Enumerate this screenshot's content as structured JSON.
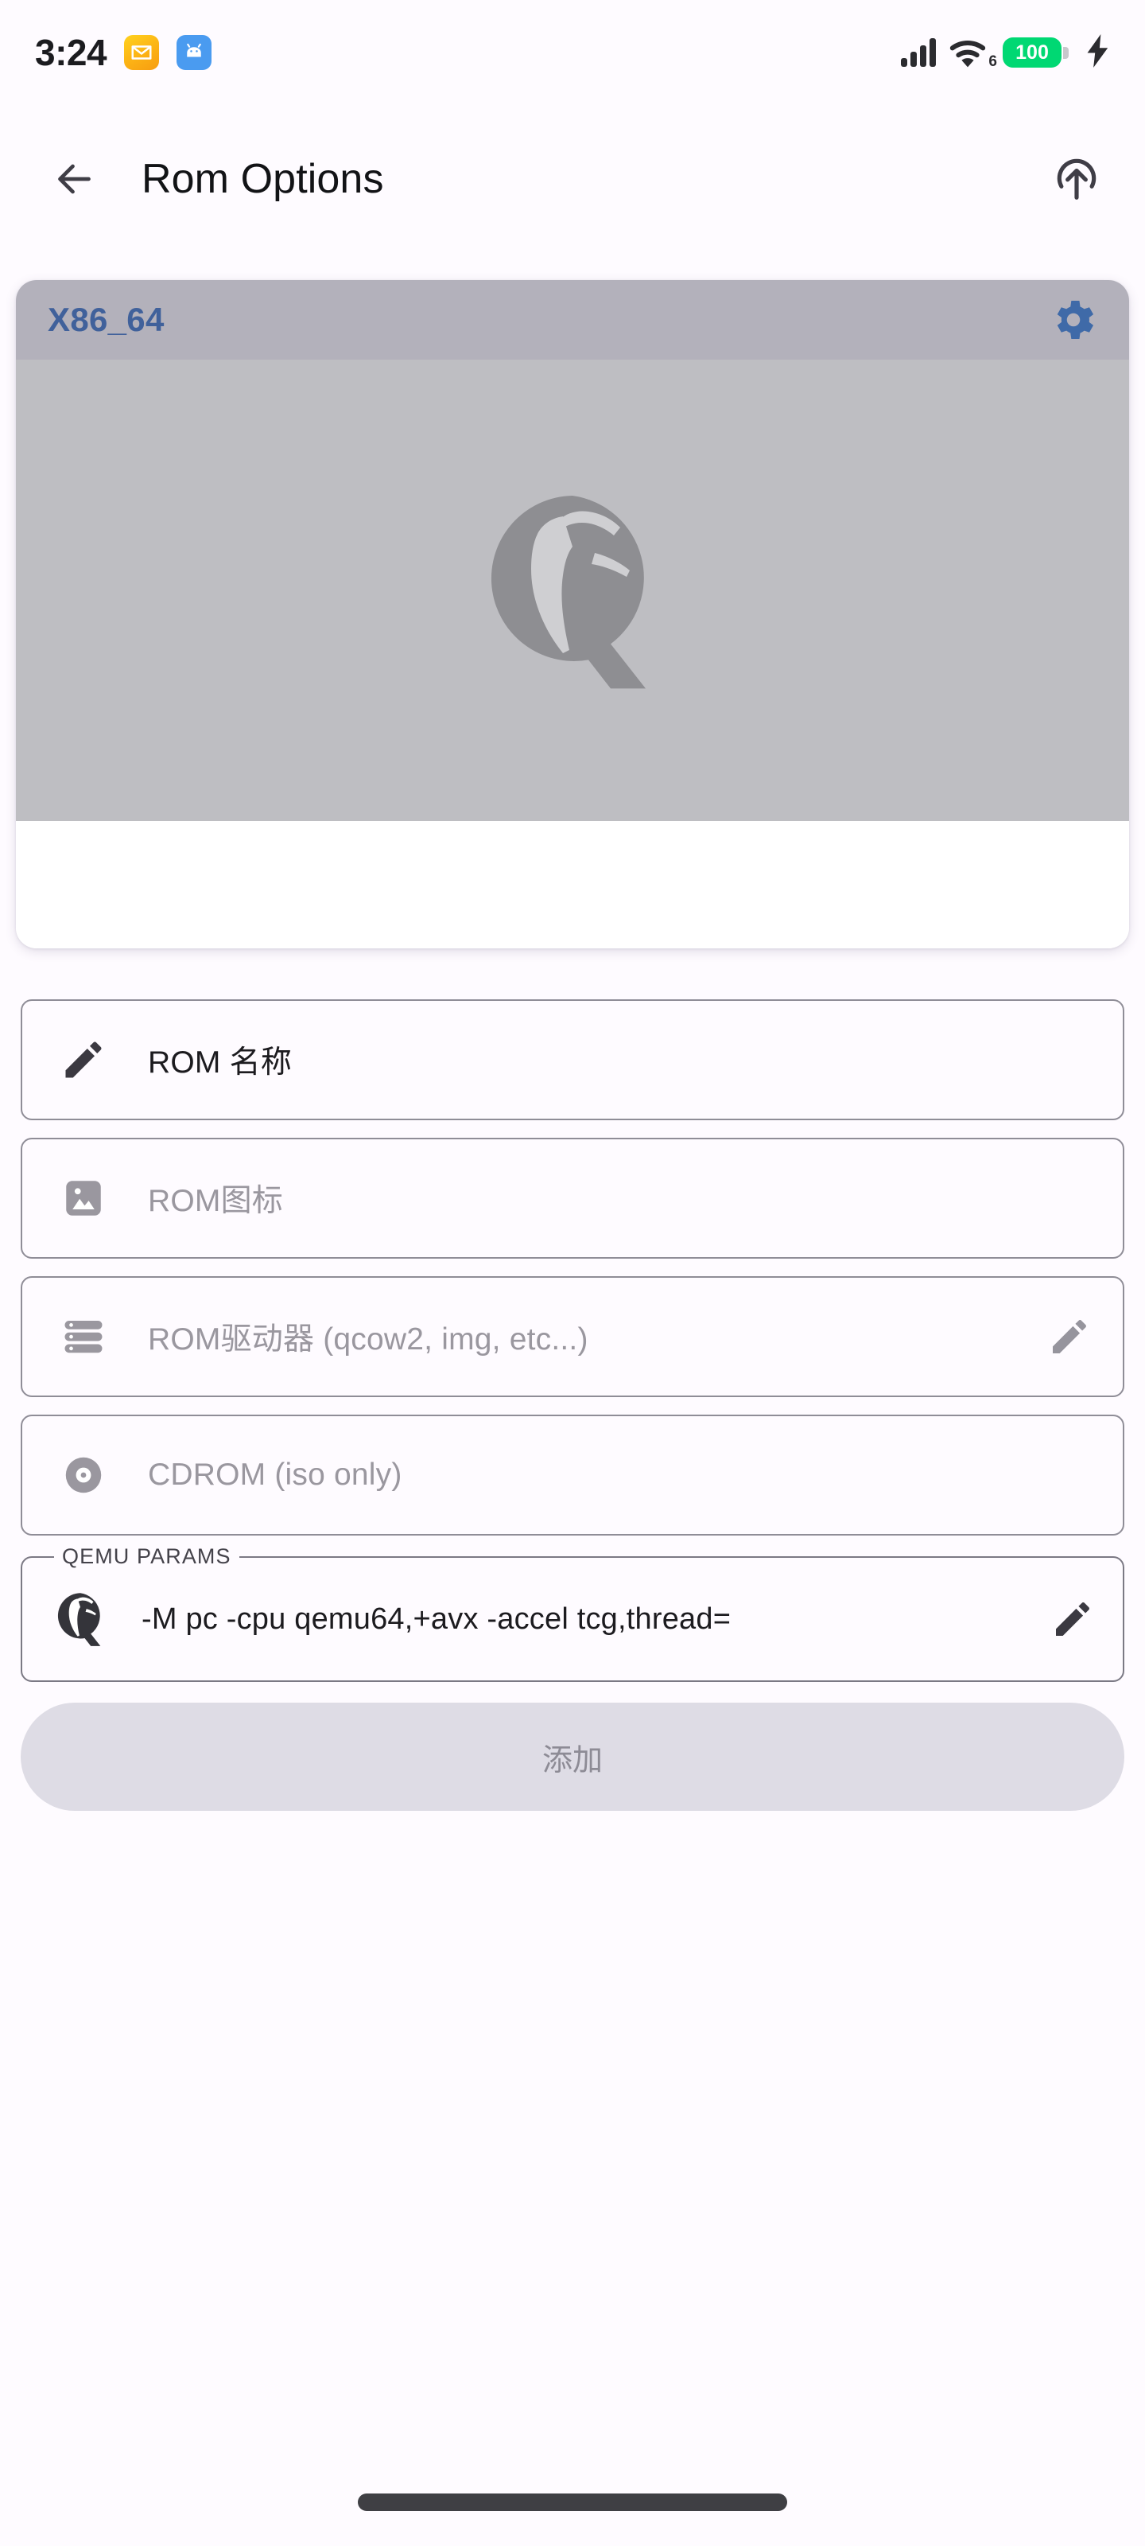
{
  "status_bar": {
    "time": "3:24",
    "notifications": [
      {
        "name": "mail-notification-icon",
        "label": "mail"
      },
      {
        "name": "android-notification-icon",
        "label": "android"
      }
    ],
    "signal": {
      "icon": "cellular-signal-icon",
      "bars": 4
    },
    "wifi": {
      "icon": "wifi-icon",
      "generation": "6"
    },
    "battery": {
      "level": "100",
      "charging": true,
      "color": "#00d873"
    }
  },
  "app_bar": {
    "back_icon": "back-arrow-icon",
    "title": "Rom Options",
    "action_icon": "upload-arrow-icon"
  },
  "rom_card": {
    "title": "X86_64",
    "title_color": "#40619b",
    "header_bg": "#b3b1bb",
    "image_bg": "#bebec2",
    "gear_icon": "gear-icon",
    "preview_icon": "qemu-logo-icon"
  },
  "fields": [
    {
      "icon": "pencil-icon",
      "label": "ROM 名称",
      "filled": true,
      "trailing_icon": null
    },
    {
      "icon": "image-icon",
      "label": "ROM图标",
      "filled": false,
      "trailing_icon": null
    },
    {
      "icon": "storage-drives-icon",
      "label": "ROM驱动器 (qcow2, img, etc...)",
      "filled": false,
      "trailing_icon": "pencil-icon"
    },
    {
      "icon": "cdrom-disc-icon",
      "label": "CDROM (iso only)",
      "filled": false,
      "trailing_icon": null
    }
  ],
  "qemu_params": {
    "legend": "QEMU PARAMS",
    "icon": "qemu-logo-icon",
    "value": "-M pc -cpu qemu64,+avx -accel tcg,thread=",
    "trailing_icon": "pencil-icon"
  },
  "add_button": {
    "label": "添加",
    "enabled": false,
    "bg": "#dedce5",
    "text_color": "#8d8b95"
  },
  "nav_bar": {
    "pill": "gesture-nav-pill"
  }
}
